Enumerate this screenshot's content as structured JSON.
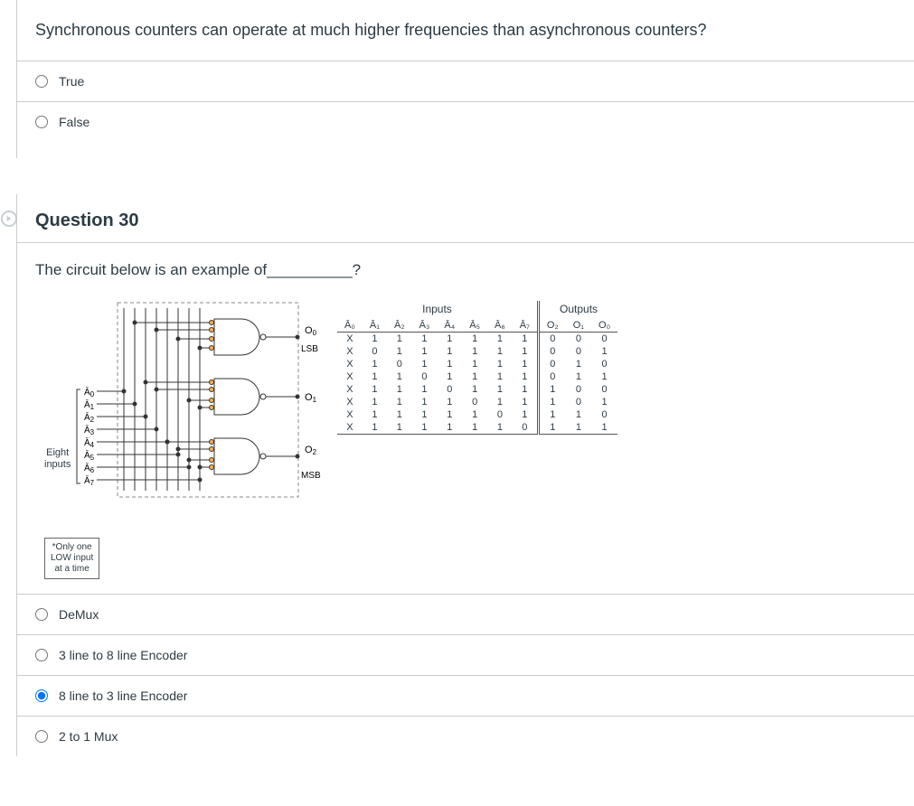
{
  "q29": {
    "text": "Synchronous counters can operate at much higher frequencies than asynchronous counters?",
    "options": [
      "True",
      "False"
    ]
  },
  "q30": {
    "header": "Question 30",
    "prompt_prefix": "The circuit below is an example of",
    "prompt_suffix": "?",
    "blank": "__________",
    "inputs_label_line1": "Eight",
    "inputs_label_line2": "inputs",
    "note_line1": "*Only one",
    "note_line2": "LOW input",
    "note_line3": "at a time",
    "outputs": {
      "o0": "O₀",
      "o1": "O₁",
      "o2": "O₂"
    },
    "lsb": "LSB",
    "msb": "MSB",
    "input_pins": [
      "Ā₀",
      "Ā₁",
      "Ā₂",
      "Ā₃",
      "Ā₄",
      "Ā₅",
      "Ā₆",
      "Ā₇"
    ],
    "tt": {
      "headers": {
        "inputs": "Inputs",
        "outputs": "Outputs"
      },
      "cols_in": [
        "Ā₀",
        "Ā₁",
        "Ā₂",
        "Ā₃",
        "Ā₄",
        "Ā₅",
        "Ā₆",
        "Ā₇"
      ],
      "cols_out": [
        "O₂",
        "O₁",
        "O₀"
      ],
      "rows": [
        [
          "X",
          "1",
          "1",
          "1",
          "1",
          "1",
          "1",
          "1",
          "0",
          "0",
          "0"
        ],
        [
          "X",
          "0",
          "1",
          "1",
          "1",
          "1",
          "1",
          "1",
          "0",
          "0",
          "1"
        ],
        [
          "X",
          "1",
          "0",
          "1",
          "1",
          "1",
          "1",
          "1",
          "0",
          "1",
          "0"
        ],
        [
          "X",
          "1",
          "1",
          "0",
          "1",
          "1",
          "1",
          "1",
          "0",
          "1",
          "1"
        ],
        [
          "X",
          "1",
          "1",
          "1",
          "0",
          "1",
          "1",
          "1",
          "1",
          "0",
          "0"
        ],
        [
          "X",
          "1",
          "1",
          "1",
          "1",
          "0",
          "1",
          "1",
          "1",
          "0",
          "1"
        ],
        [
          "X",
          "1",
          "1",
          "1",
          "1",
          "1",
          "0",
          "1",
          "1",
          "1",
          "0"
        ],
        [
          "X",
          "1",
          "1",
          "1",
          "1",
          "1",
          "1",
          "0",
          "1",
          "1",
          "1"
        ]
      ]
    },
    "answers": [
      "DeMux",
      "3 line to 8 line Encoder",
      "8 line to 3 line Encoder",
      "2 to 1 Mux"
    ],
    "selected": 2
  }
}
